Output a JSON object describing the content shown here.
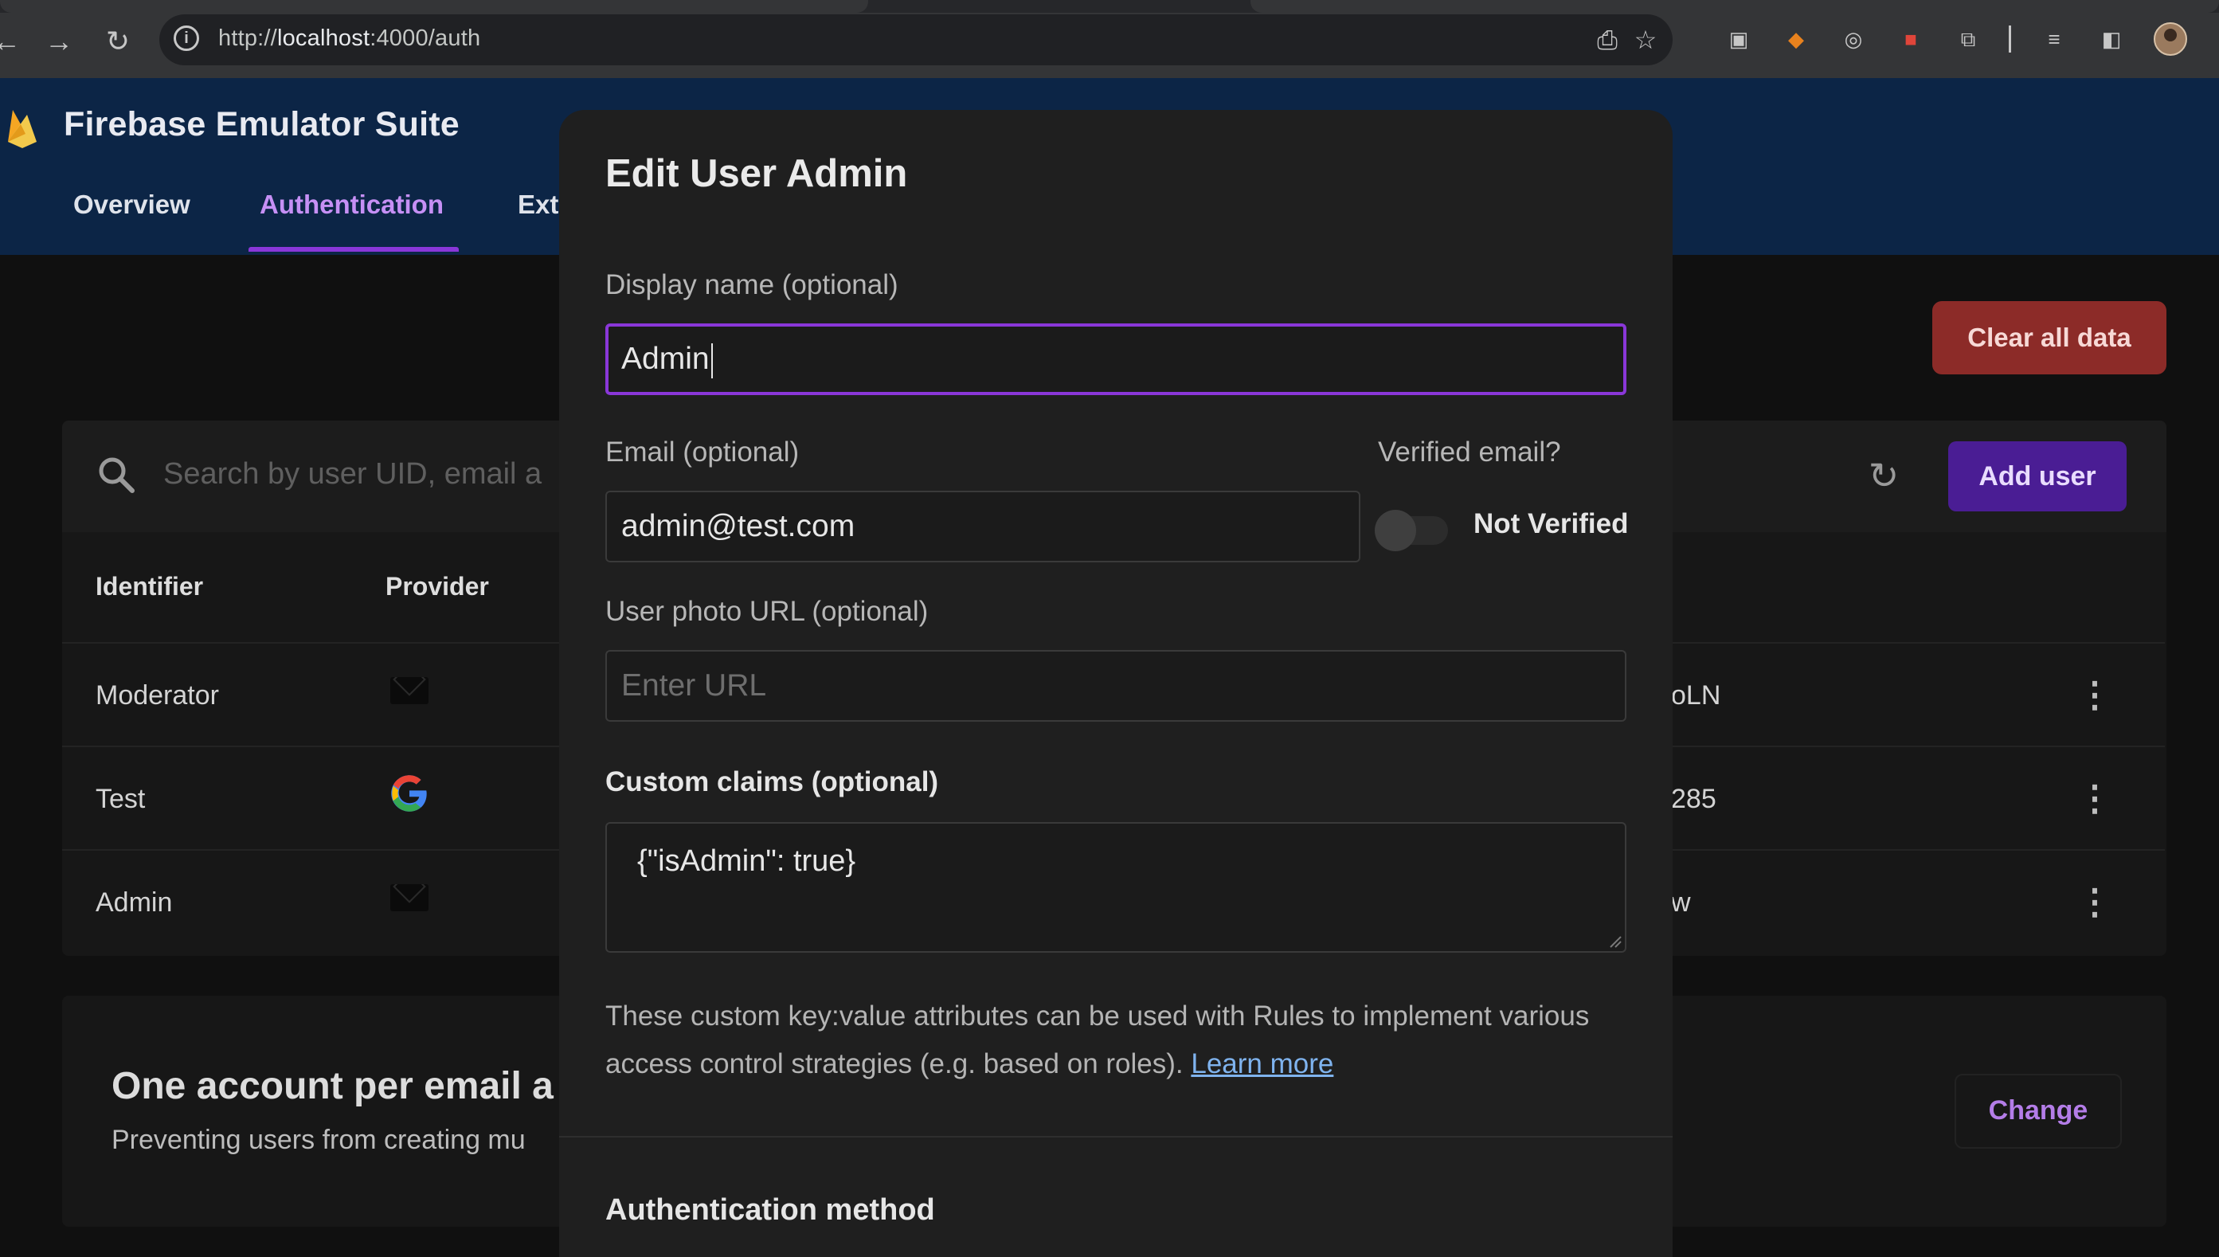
{
  "browser": {
    "url_prefix": "http://",
    "url_host": "localhost",
    "url_path": ":4000/auth",
    "icons": [
      "back-icon",
      "forward-icon",
      "reload-icon",
      "site-info-icon",
      "install-icon",
      "bookmark-star-icon",
      "tab-search-icon",
      "metamask-icon",
      "extension-eyes-icon",
      "extension-red-icon",
      "extensions-puzzle-icon",
      "reading-list-icon",
      "side-panel-icon",
      "profile-avatar"
    ]
  },
  "app": {
    "title": "Firebase Emulator Suite",
    "tabs": [
      {
        "label": "Overview"
      },
      {
        "label": "Authentication"
      },
      {
        "label": "Ext"
      }
    ],
    "clear_button": "Clear all data",
    "search_placeholder": "Search by user UID, email a",
    "add_user_button": "Add user",
    "table": {
      "headers": [
        "Identifier",
        "Provider"
      ],
      "rows": [
        {
          "identifier": "Moderator",
          "provider": "email",
          "uid_tail": "oLN"
        },
        {
          "identifier": "Test",
          "provider": "google",
          "uid_tail": "285"
        },
        {
          "identifier": "Admin",
          "provider": "email",
          "uid_tail": "w"
        }
      ]
    },
    "policy": {
      "title": "One account per email a",
      "subtitle": "Preventing users from creating mu",
      "change_button": "Change"
    }
  },
  "dialog": {
    "title": "Edit User Admin",
    "display_name_label": "Display name (optional)",
    "display_name_value": "Admin",
    "email_label": "Email (optional)",
    "email_value": "admin@test.com",
    "verified_label": "Verified email?",
    "verified_state": "Not Verified",
    "photo_label": "User photo URL (optional)",
    "photo_placeholder": "Enter URL",
    "claims_label": "Custom claims (optional)",
    "claims_value": "{\"isAdmin\": true}",
    "help_text": "These custom key:value attributes can be used with Rules to implement various access control strategies (e.g. based on roles).",
    "learn_more": "Learn more",
    "auth_method_title": "Authentication method"
  },
  "colors": {
    "app_bar": "#0c2546",
    "accent_purple": "#8a37d8",
    "danger": "#8c2b28",
    "primary_button": "#4a1d94",
    "link": "#7fb3ee"
  }
}
